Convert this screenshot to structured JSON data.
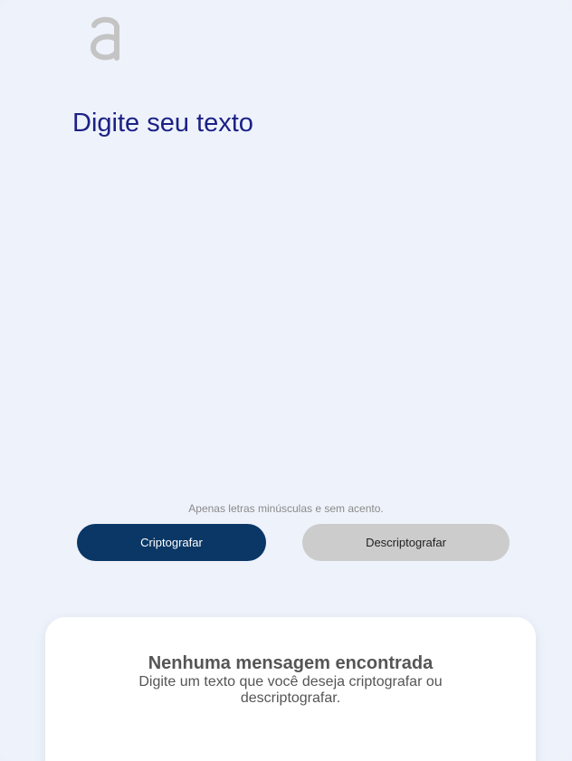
{
  "brand": {
    "logo_icon": "letter-a-logo",
    "logo_color": "#c4c4c4"
  },
  "input": {
    "placeholder": "Digite seu texto",
    "value": ""
  },
  "hint": {
    "text": "Apenas letras minúsculas e sem acento."
  },
  "actions": {
    "encrypt_label": "Criptografar",
    "decrypt_label": "Descriptografar"
  },
  "result": {
    "title": "Nenhuma mensagem encontrada",
    "description": "Digite um texto que você deseja criptografar ou descriptografar."
  },
  "colors": {
    "background": "#eef2fb",
    "accent_dark": "#0a3766",
    "input_text": "#1c2185",
    "secondary_button": "#cccccc"
  }
}
